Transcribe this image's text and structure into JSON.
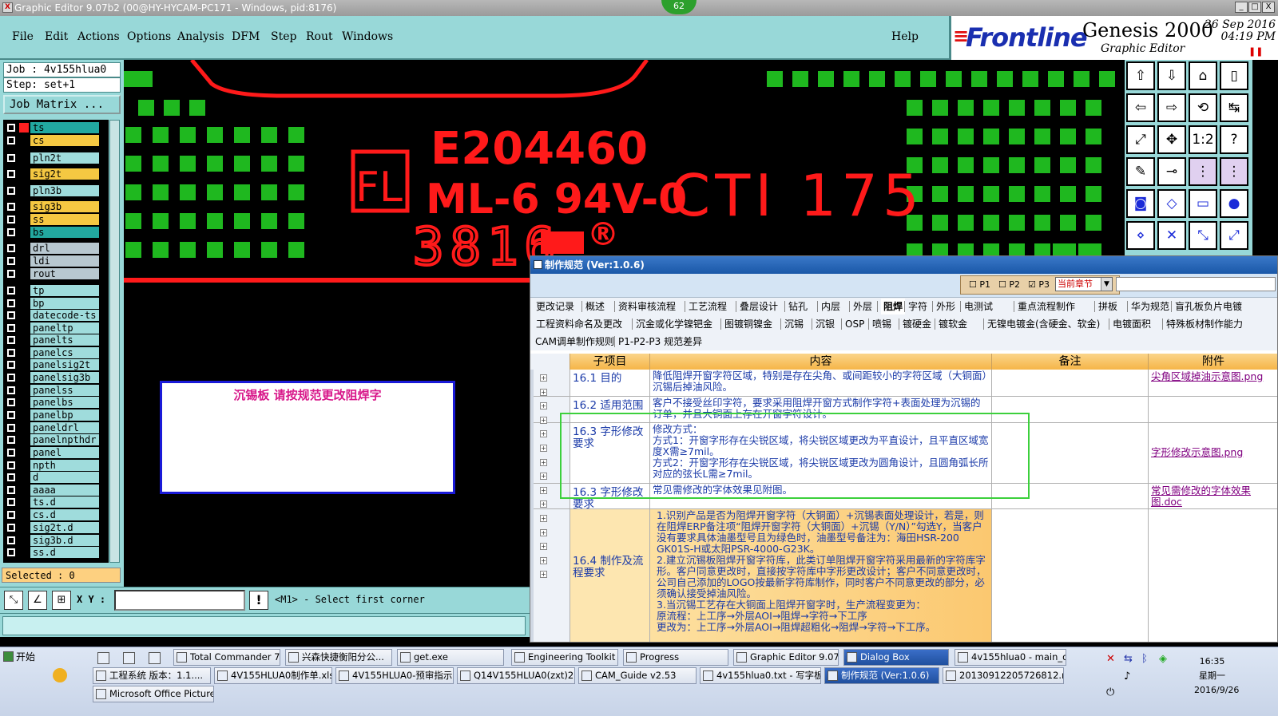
{
  "window": {
    "title": "Graphic Editor 9.07b2 (00@HY-HYCAM-PC171 - Windows, pid:8176)",
    "badge": "62",
    "controls": [
      "_",
      "□",
      "X"
    ]
  },
  "menu": {
    "items": [
      "File",
      "Edit",
      "Actions",
      "Options",
      "Analysis",
      "DFM",
      "Step",
      "Rout",
      "Windows"
    ],
    "help": "Help"
  },
  "brand": {
    "logo": "Frontline",
    "logo_mark": "≡",
    "product": "Genesis 2000",
    "subtitle": "Graphic Editor",
    "date": "26 Sep 2016",
    "time": "04:19 PM",
    "pause": "❚❚"
  },
  "job": {
    "job_label": "Job : 4v155hlua0",
    "step_label": "Step: set+1",
    "matrix_button": "Job Matrix ..."
  },
  "layers": [
    {
      "name": "ts",
      "color": "#22a8a0"
    },
    {
      "name": "cs",
      "color": "#f5c842"
    },
    {
      "name": "pln2t",
      "color": "#9fdcdc"
    },
    {
      "name": "sig2t",
      "color": "#f5c842"
    },
    {
      "name": "pln3b",
      "color": "#9fdcdc"
    },
    {
      "name": "sig3b",
      "color": "#f5c842"
    },
    {
      "name": "ss",
      "color": "#f5c842"
    },
    {
      "name": "bs",
      "color": "#22a8a0"
    },
    {
      "name": "drl",
      "color": "#b8c8d0"
    },
    {
      "name": "ldi",
      "color": "#b8c8d0"
    },
    {
      "name": "rout",
      "color": "#b8c8d0"
    },
    {
      "name": "tp",
      "color": "#9fdcdc"
    },
    {
      "name": "bp",
      "color": "#9fdcdc"
    },
    {
      "name": "datecode-ts",
      "color": "#9fdcdc"
    },
    {
      "name": "paneltp",
      "color": "#9fdcdc"
    },
    {
      "name": "panelts",
      "color": "#9fdcdc"
    },
    {
      "name": "panelcs",
      "color": "#9fdcdc"
    },
    {
      "name": "panelsig2t",
      "color": "#9fdcdc"
    },
    {
      "name": "panelsig3b",
      "color": "#9fdcdc"
    },
    {
      "name": "panelss",
      "color": "#9fdcdc"
    },
    {
      "name": "panelbs",
      "color": "#9fdcdc"
    },
    {
      "name": "panelbp",
      "color": "#9fdcdc"
    },
    {
      "name": "paneldrl",
      "color": "#9fdcdc"
    },
    {
      "name": "panelnpthdr",
      "color": "#9fdcdc"
    },
    {
      "name": "panel",
      "color": "#9fdcdc"
    },
    {
      "name": "npth",
      "color": "#9fdcdc"
    },
    {
      "name": "d",
      "color": "#9fdcdc"
    },
    {
      "name": "aaaa",
      "color": "#9fdcdc"
    },
    {
      "name": "ts.d",
      "color": "#9fdcdc"
    },
    {
      "name": "cs.d",
      "color": "#9fdcdc"
    },
    {
      "name": "sig2t.d",
      "color": "#9fdcdc"
    },
    {
      "name": "sig3b.d",
      "color": "#9fdcdc"
    },
    {
      "name": "ss.d",
      "color": "#9fdcdc"
    }
  ],
  "selected": "Selected : 0",
  "canvas": {
    "cert": "E204460",
    "ul_mark": "FL",
    "material": "ML-6 94V-0",
    "cti": "CTI 175",
    "datecode": "3816",
    "registered": "®",
    "note": "沉锡板   请按规范更改阻焊字"
  },
  "bottom": {
    "xy_label": "X Y :",
    "xy_value": "",
    "prompt": "<M1> - Select first corner"
  },
  "dialog": {
    "title": "制作规范 (Ver:1.0.6)",
    "filters": [
      "P1",
      "P2",
      "P3"
    ],
    "chapter_select": "当前章节",
    "tabs_row1": [
      "更改记录",
      "概述",
      "资料审核流程",
      "工艺流程",
      "叠层设计",
      "钻孔",
      "内层",
      "外层",
      "阻焊",
      "字符",
      "外形",
      "电测试",
      "重点流程制作",
      "拼板",
      "华为规范",
      "盲孔板负片电镀"
    ],
    "tabs_row2": [
      "工程资料命名及更改",
      "沉金或化学镍钯金",
      "图镀铜镍金",
      "沉锡",
      "沉银",
      "OSP",
      "喷锡",
      "镀硬金",
      "镀软金",
      "无镍电镀金(含硬金、软金)",
      "电镀面积",
      "特殊板材制作能力"
    ],
    "tabs_row3": [
      "CAM调单制作规则",
      "P1-P2-P3 规范差异"
    ],
    "active_tab": "阻焊",
    "columns": [
      "子项目",
      "内容",
      "备注",
      "附件"
    ],
    "rows": [
      {
        "sub": "16.1 目的",
        "content": "降低阻焊开窗字符区域，特别是存在尖角、或间距较小的字符区域（大铜面）沉锡后掉油风险。",
        "note": "",
        "attach": "尖角区域掉油示意图.png"
      },
      {
        "sub": "16.2 适用范围",
        "content": "客户不接受丝印字符，要求采用阻焊开窗方式制作字符+表面处理为沉锡的订单，并且大铜面上存在开窗字符设计。",
        "note": "",
        "attach": ""
      },
      {
        "sub": "16.3 字形修改要求",
        "content": "修改方式：\n方式1：开窗字形存在尖锐区域，将尖锐区域更改为平直设计，且平直区域宽度X需≥7mil。\n方式2：开窗字形存在尖锐区域，将尖锐区域更改为圆角设计，且圆角弧长所对应的弦长L需≥7mil。",
        "note": "",
        "attach": "字形修改示意图.png"
      },
      {
        "sub": "16.3 字形修改要求",
        "content": "常见需修改的字体效果见附图。",
        "note": "",
        "attach": "常见需修改的字体效果图.doc"
      },
      {
        "sub": "16.4 制作及流程要求",
        "content": "1.识别产品是否为阻焊开窗字符（大铜面）+沉锡表面处理设计，若是，则在阻焊ERP备注项“阻焊开窗字符（大铜面）+沉锡（Y/N）”勾选Y，当客户没有要求具体油墨型号且为绿色时，油墨型号备注为：海田HSR-200 GK01S-H或太阳PSR-4000-G23K。\n2.建立沉锡板阻焊开窗字符库，此类订单阻焊开窗字符采用最新的字符库字形。客户同意更改时，直接按字符库中字形更改设计；客户不同意更改时，公司自己添加的LOGO按最新字符库制作，同时客户不同意更改的部分，必须确认接受掉油风险。\n3.当沉锡工艺存在大铜面上阻焊开窗字时，生产流程变更为：\n原流程：上工序→外层AOI→阻焊→字符→下工序\n更改为：上工序→外层AOI→阻焊超粗化→阻焊→字符→下工序。",
        "note": "",
        "attach": ""
      }
    ]
  },
  "taskbar": {
    "start": "开始",
    "row1": [
      {
        "label": "Total Commander 7.0..."
      },
      {
        "label": "兴森快捷衡阳分公..."
      },
      {
        "label": "get.exe"
      },
      {
        "label": "Engineering Toolkit 9..."
      },
      {
        "label": "Progress"
      },
      {
        "label": "Graphic Editor 9.07b..."
      },
      {
        "label": "Dialog Box",
        "active": true
      },
      {
        "label": "4v155hlua0 - main_qa"
      }
    ],
    "row2": [
      {
        "label": "工程系统  版本：1.1...."
      },
      {
        "label": "4V155HLUA0制作单.xls..."
      },
      {
        "label": "4V155HLUA0-预审指示..."
      },
      {
        "label": "Q14V155HLUA0(zxt)20..."
      },
      {
        "label": "CAM_Guide v2.53"
      },
      {
        "label": "4v155hlua0.txt - 写字板"
      },
      {
        "label": "制作规范 (Ver:1.0.6)",
        "active": true
      },
      {
        "label": "20130912205726812.rt..."
      }
    ],
    "row3": [
      {
        "label": "Microsoft Office Picture ..."
      }
    ],
    "clock": {
      "time": "16:35",
      "weekday": "星期一",
      "date": "2016/9/26"
    }
  },
  "colors": {
    "panel": "#98d8d8",
    "pad": "#1fb81f",
    "silk": "#ff1a1a",
    "dialog_header": "#f5b548",
    "highlight": "#3cd03c"
  }
}
